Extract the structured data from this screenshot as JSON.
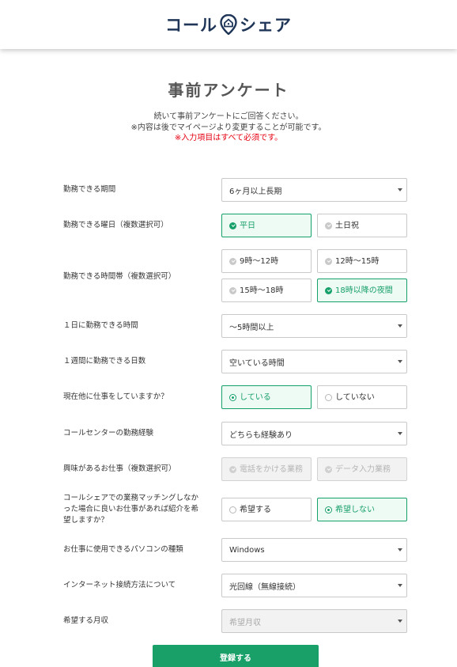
{
  "brand": {
    "part1": "コール",
    "part2": "シェア"
  },
  "page_title": "事前アンケート",
  "intro": {
    "line1": "続いて事前アンケートにご回答ください。",
    "line2": "※内容は後でマイページより変更することが可能です。",
    "required_note": "※入力項目はすべて必須です。"
  },
  "period": {
    "label": "勤務できる期間",
    "value": "6ヶ月以上長期"
  },
  "days": {
    "label": "勤務できる曜日（複数選択可）",
    "options": [
      "平日",
      "土日祝"
    ],
    "checked": [
      true,
      false
    ]
  },
  "timeslots": {
    "label": "勤務できる時間帯（複数選択可）",
    "options": [
      "9時〜12時",
      "12時〜15時",
      "15時〜18時",
      "18時以降の夜間"
    ],
    "checked": [
      false,
      false,
      false,
      true
    ]
  },
  "daily_hours": {
    "label": "１日に勤務できる時間",
    "value": "〜5時間以上"
  },
  "weekly_days": {
    "label": "１週間に勤務できる日数",
    "value": "空いている時間"
  },
  "other_job": {
    "label": "現在他に仕事をしていますか？",
    "options": [
      "している",
      "していない"
    ],
    "selected": "している"
  },
  "callcenter_exp": {
    "label": "コールセンターの勤務経験",
    "value": "どちらも経験あり"
  },
  "interests": {
    "label": "興味があるお仕事（複数選択可）",
    "options": [
      "電話をかける業務",
      "データ入力業務"
    ],
    "disabled": true
  },
  "matching": {
    "label": "コールシェアでの業務マッチングしなかった場合に良いお仕事があれば紹介を希望しますか？",
    "options": [
      "希望する",
      "希望しない"
    ],
    "selected": "希望しない"
  },
  "pc_type": {
    "label": "お仕事に使用できるパソコンの種類",
    "value": "Windows"
  },
  "internet": {
    "label": "インターネット接続方法について",
    "value": "光回線（無線接続）"
  },
  "salary": {
    "label": "希望する月収",
    "placeholder": "希望月収"
  },
  "submit_label": "登録する",
  "colors": {
    "accent": "#18a068",
    "brand": "#1e3557",
    "required": "#e60012"
  }
}
